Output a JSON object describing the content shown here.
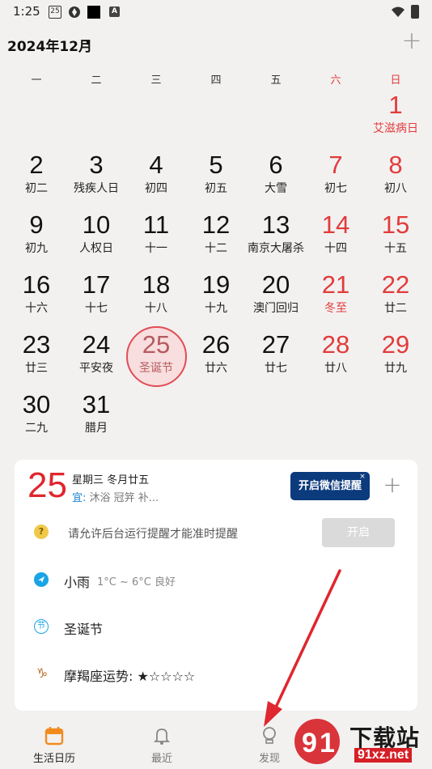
{
  "status_bar": {
    "time": "1:25",
    "calendar_icon_text": "25"
  },
  "header": {
    "month_title": "2024年12月",
    "caret": "▾",
    "plus": "+"
  },
  "weekdays": [
    "一",
    "二",
    "三",
    "四",
    "五",
    "六",
    "日"
  ],
  "calendar_rows": [
    [
      {
        "num": "",
        "sub": ""
      },
      {
        "num": "",
        "sub": ""
      },
      {
        "num": "",
        "sub": ""
      },
      {
        "num": "",
        "sub": ""
      },
      {
        "num": "",
        "sub": ""
      },
      {
        "num": "",
        "sub": ""
      },
      {
        "num": "1",
        "sub": "艾滋病日"
      }
    ],
    [
      {
        "num": "2",
        "sub": "初二"
      },
      {
        "num": "3",
        "sub": "残疾人日"
      },
      {
        "num": "4",
        "sub": "初四"
      },
      {
        "num": "5",
        "sub": "初五"
      },
      {
        "num": "6",
        "sub": "大雪"
      },
      {
        "num": "7",
        "sub": "初七"
      },
      {
        "num": "8",
        "sub": "初八"
      }
    ],
    [
      {
        "num": "9",
        "sub": "初九"
      },
      {
        "num": "10",
        "sub": "人权日"
      },
      {
        "num": "11",
        "sub": "十一"
      },
      {
        "num": "12",
        "sub": "十二"
      },
      {
        "num": "13",
        "sub": "南京大屠杀"
      },
      {
        "num": "14",
        "sub": "十四"
      },
      {
        "num": "15",
        "sub": "十五"
      }
    ],
    [
      {
        "num": "16",
        "sub": "十六"
      },
      {
        "num": "17",
        "sub": "十七"
      },
      {
        "num": "18",
        "sub": "十八"
      },
      {
        "num": "19",
        "sub": "十九"
      },
      {
        "num": "20",
        "sub": "澳门回归"
      },
      {
        "num": "21",
        "sub": "冬至"
      },
      {
        "num": "22",
        "sub": "廿二"
      }
    ],
    [
      {
        "num": "23",
        "sub": "廿三"
      },
      {
        "num": "24",
        "sub": "平安夜"
      },
      {
        "num": "25",
        "sub": "圣诞节"
      },
      {
        "num": "26",
        "sub": "廿六"
      },
      {
        "num": "27",
        "sub": "廿七"
      },
      {
        "num": "28",
        "sub": "廿八"
      },
      {
        "num": "29",
        "sub": "廿九"
      }
    ],
    [
      {
        "num": "30",
        "sub": "二九"
      },
      {
        "num": "31",
        "sub": "腊月"
      }
    ]
  ],
  "card": {
    "day": "25",
    "date_text": "星期三 冬月廿五",
    "yi_label": "宜:",
    "yi_text": " 沐浴 冠笄 补...",
    "wechat_button": "开启微信提醒",
    "close_x": "×",
    "plus": "+",
    "warn_icon": "?",
    "warn_text": "请允许后台运行提醒才能准时提醒",
    "open_button": "开启",
    "weather_main": "小雨",
    "weather_sub": "1°C ~ 6°C     良好",
    "festival_icon": "节",
    "festival_text": "圣诞节",
    "zodiac_icon": "♑",
    "zodiac_text": "摩羯座运势: ★☆☆☆☆"
  },
  "bottom_nav": {
    "calendar": "生活日历",
    "recent": "最近",
    "discover": "发现"
  },
  "watermark": {
    "main": "下载站",
    "sub": "91xz.net"
  },
  "colors": {
    "accent_red": "#e23b3b",
    "today_ring": "#e14c55",
    "wechat_button": "#0b3a7d",
    "weather_blue": "#1aa4e6",
    "annotation_arrow": "#e0262e"
  }
}
